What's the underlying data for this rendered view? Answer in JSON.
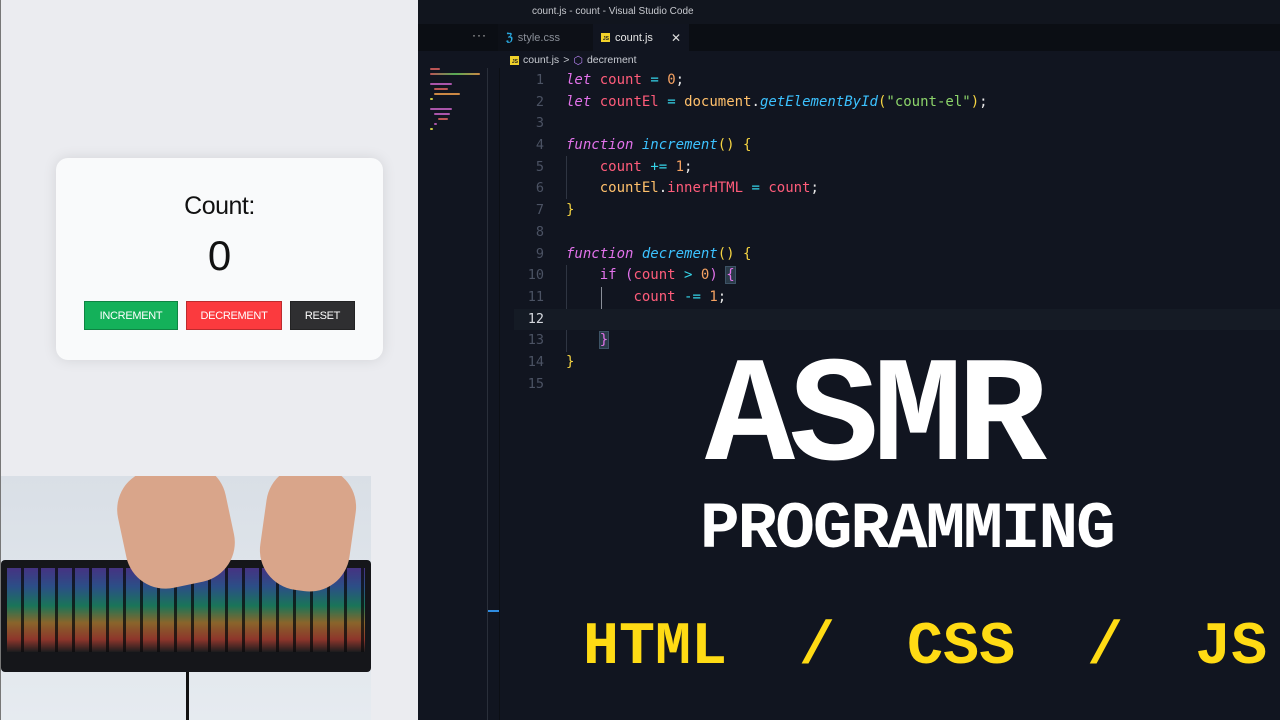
{
  "window": {
    "title": "count.js - count - Visual Studio Code"
  },
  "tabs": [
    {
      "label": "style.css",
      "icon": "css-icon",
      "active": false
    },
    {
      "label": "count.js",
      "icon": "js-icon",
      "active": true,
      "close_glyph": "✕"
    }
  ],
  "more_glyph": "···",
  "breadcrumb": {
    "file": "count.js",
    "separator": ">",
    "symbol": "decrement"
  },
  "editor": {
    "current_line": 12,
    "line_numbers": [
      "1",
      "2",
      "3",
      "4",
      "5",
      "6",
      "7",
      "8",
      "9",
      "10",
      "11",
      "12",
      "13",
      "14",
      "15"
    ],
    "lines": [
      "let count = 0;",
      "let countEl = document.getElementById(\"count-el\");",
      "",
      "function increment() {",
      "    count += 1;",
      "    countEl.innerHTML = count;",
      "}",
      "",
      "function decrement() {",
      "    if (count > 0) {",
      "        count -= 1;",
      "",
      "    }",
      "}",
      ""
    ]
  },
  "preview": {
    "title": "Count:",
    "count": "0",
    "buttons": {
      "increment": "INCREMENT",
      "decrement": "DECREMENT",
      "reset": "RESET"
    },
    "colors": {
      "increment": "#14b15a",
      "decrement": "#fb3a3e",
      "reset": "#2f2f31"
    }
  },
  "overlay": {
    "title": "ASMR",
    "subtitle": "PROGRAMMING",
    "tech": "HTML / CSS / JS",
    "title_color": "#ffffff",
    "tech_color": "#ffdb14"
  },
  "webcam": {
    "description": "hands typing on RGB mechanical keyboard"
  }
}
